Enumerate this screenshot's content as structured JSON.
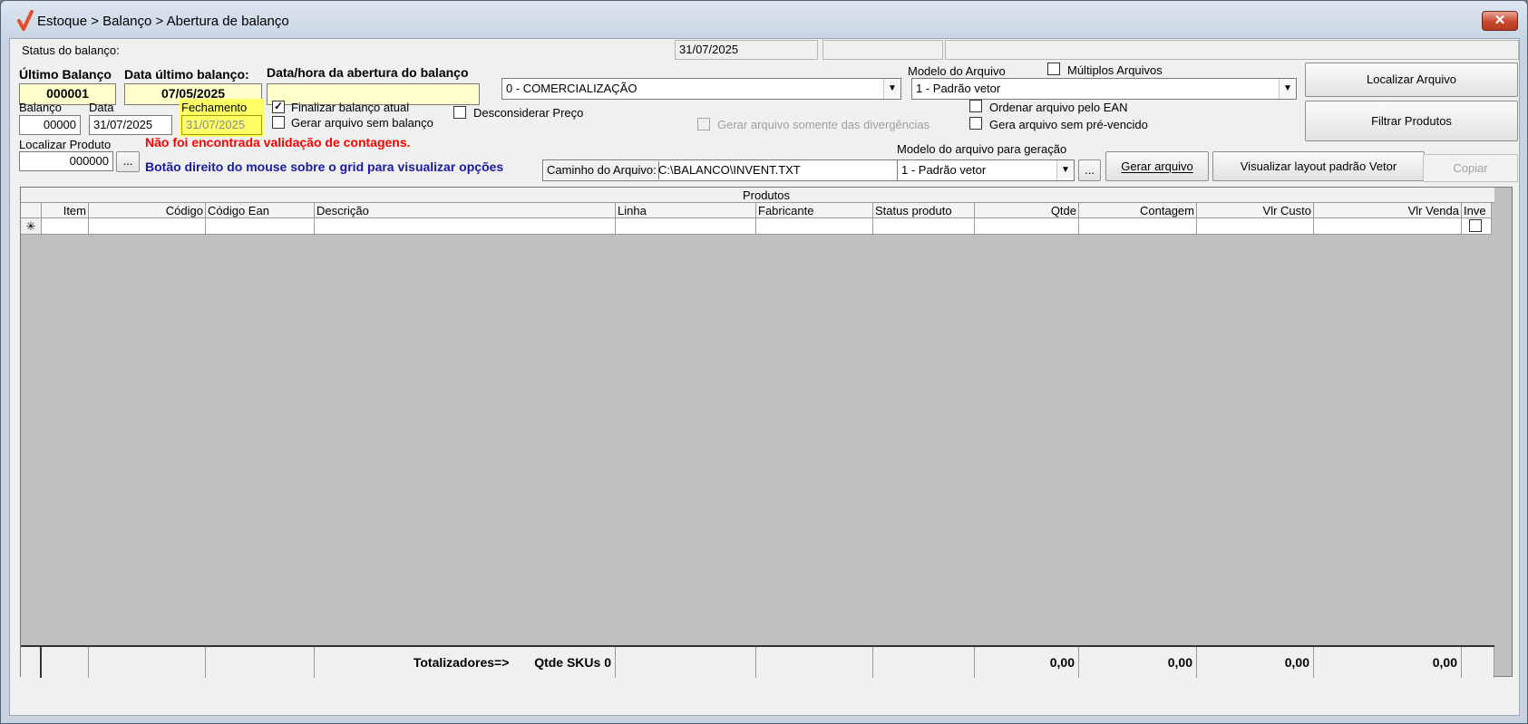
{
  "window": {
    "title": "Estoque > Balanço > Abertura de balanço",
    "close_label": "✕"
  },
  "status": {
    "label": "Status do balanço:",
    "date": "31/07/2025",
    "field2": "",
    "field3": ""
  },
  "ultimo_balanco": {
    "label": "Último Balanço",
    "value": "000001"
  },
  "data_ultimo": {
    "label": "Data último balanço:",
    "value": "07/05/2025"
  },
  "abertura": {
    "label": "Data/hora da abertura do balanço",
    "value": ""
  },
  "comercializacao": {
    "value": "0 - COMERCIALIZAÇÃO"
  },
  "modelo_arquivo": {
    "label": "Modelo do Arquivo",
    "value": "1 - Padrão vetor"
  },
  "multiplos": {
    "label": "Múltiplos Arquivos",
    "checked": false
  },
  "balanco": {
    "label": "Balanço",
    "value": "00000"
  },
  "data": {
    "label": "Data",
    "value": "31/07/2025"
  },
  "fechamento": {
    "label": "Fechamento",
    "value": "31/07/2025"
  },
  "finalizar": {
    "label": "Finalizar balanço atual",
    "mark": "✓"
  },
  "gerar_sem_balanco": {
    "label": "Gerar arquivo sem balanço"
  },
  "desconsiderar": {
    "label": "Desconsiderar Preço"
  },
  "gerar_divergencias": {
    "label": "Gerar arquivo somente das divergências"
  },
  "ordenar_ean": {
    "label": "Ordenar arquivo pelo EAN"
  },
  "pre_vencido": {
    "label": "Gera arquivo sem pré-vencido"
  },
  "localizar_produto": {
    "label": "Localizar Produto",
    "value": "000000",
    "btn": "..."
  },
  "msgs": {
    "error": "Não foi encontrada validação de contagens.",
    "hint": "Botão direito do mouse sobre o grid para visualizar opções"
  },
  "caminho": {
    "label": "Caminho do Arquivo:",
    "value": "C:\\BALANCO\\INVENT.TXT"
  },
  "modelo_geracao": {
    "label": "Modelo do arquivo para geração",
    "value": "1 - Padrão vetor",
    "btn": "..."
  },
  "buttons": {
    "localizar": "Localizar Arquivo",
    "filtrar": "Filtrar Produtos",
    "gerar": "Gerar arquivo",
    "visualizar": "Visualizar layout padrão Vetor",
    "copiar": "Copiar"
  },
  "grid": {
    "caption": "Produtos",
    "new_row_marker": "✳",
    "columns": [
      "Item",
      "Código",
      "Código Ean",
      "Descrição",
      "Linha",
      "Fabricante",
      "Status produto",
      "Qtde",
      "Contagem",
      "Vlr Custo",
      "Vlr Venda",
      "Inve"
    ],
    "totals": {
      "label": "Totalizadores=>",
      "skus": "Qtde SKUs 0",
      "qtde": "0,00",
      "contagem": "0,00",
      "custo": "0,00",
      "venda": "0,00"
    }
  }
}
